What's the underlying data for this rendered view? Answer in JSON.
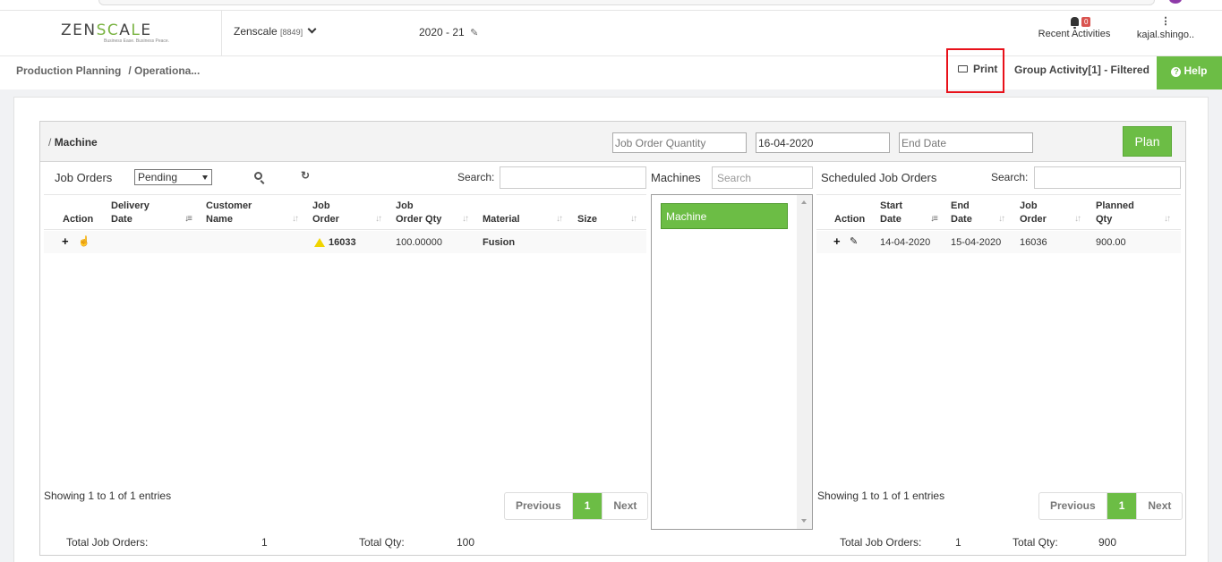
{
  "header": {
    "logo": {
      "pre": "ZEN",
      "accent": "SC",
      "mid": "A",
      "accent2": "L",
      "post": "E",
      "tagline": "Business Ease. Business Peace."
    },
    "company": "Zenscale",
    "company_code": "[8849]",
    "fiscal_year": "2020 - 21",
    "notifications_count": "0",
    "recent_activities_label": "Recent Activities",
    "user_name": "kajal.shingo.."
  },
  "subbar": {
    "breadcrumb": [
      "Production Planning",
      "/ Operationa..."
    ],
    "print_label": "Print",
    "group_activity": "Group Activity[1] - Filtered",
    "help_label": "Help"
  },
  "panel": {
    "title": "Machine",
    "title_prefix": "/",
    "job_order_qty_placeholder": "Job Order Quantity",
    "start_date_value": "16-04-2020",
    "end_date_placeholder": "End Date",
    "plan_label": "Plan"
  },
  "job_orders": {
    "title": "Job Orders",
    "status_filter": "Pending",
    "search_label": "Search:",
    "columns": [
      "Action",
      "Delivery Date",
      "Customer Name",
      "Job Order",
      "Job Order Qty",
      "Material",
      "Size"
    ],
    "col_delivery": [
      "Delivery",
      "Date"
    ],
    "col_customer": [
      "Customer",
      "Name"
    ],
    "col_job": [
      "Job",
      "Order"
    ],
    "col_qty": [
      "Job",
      "Order Qty"
    ],
    "rows": [
      {
        "delivery_date": "",
        "customer_name": "",
        "job_order": "16033",
        "qty": "100.00000",
        "material": "Fusion",
        "size": ""
      }
    ],
    "showing": "Showing 1 to 1 of 1 entries",
    "pager": {
      "prev": "Previous",
      "page": "1",
      "next": "Next"
    },
    "total_orders_label": "Total Job Orders:",
    "total_orders": "1",
    "total_qty_label": "Total Qty:",
    "total_qty": "100"
  },
  "machines": {
    "title": "Machines",
    "search_placeholder": "Search",
    "items": [
      "Machine"
    ]
  },
  "scheduled": {
    "title": "Scheduled Job Orders",
    "search_label": "Search:",
    "col_start": [
      "Start",
      "Date"
    ],
    "col_end": [
      "End",
      "Date"
    ],
    "col_job": [
      "Job",
      "Order"
    ],
    "col_planned": [
      "Planned",
      "Qty"
    ],
    "action_label": "Action",
    "rows": [
      {
        "start_date": "14-04-2020",
        "end_date": "15-04-2020",
        "job_order": "16036",
        "planned_qty": "900.00"
      }
    ],
    "showing": "Showing 1 to 1 of 1 entries",
    "pager": {
      "prev": "Previous",
      "page": "1",
      "next": "Next"
    },
    "total_orders_label": "Total Job Orders:",
    "total_orders": "1",
    "total_qty_label": "Total Qty:",
    "total_qty": "900"
  },
  "colors": {
    "accent_green": "#6cbd45",
    "highlight_red": "#e8111a",
    "badge_red": "#d9534f",
    "warning_yellow": "#f0d400"
  }
}
